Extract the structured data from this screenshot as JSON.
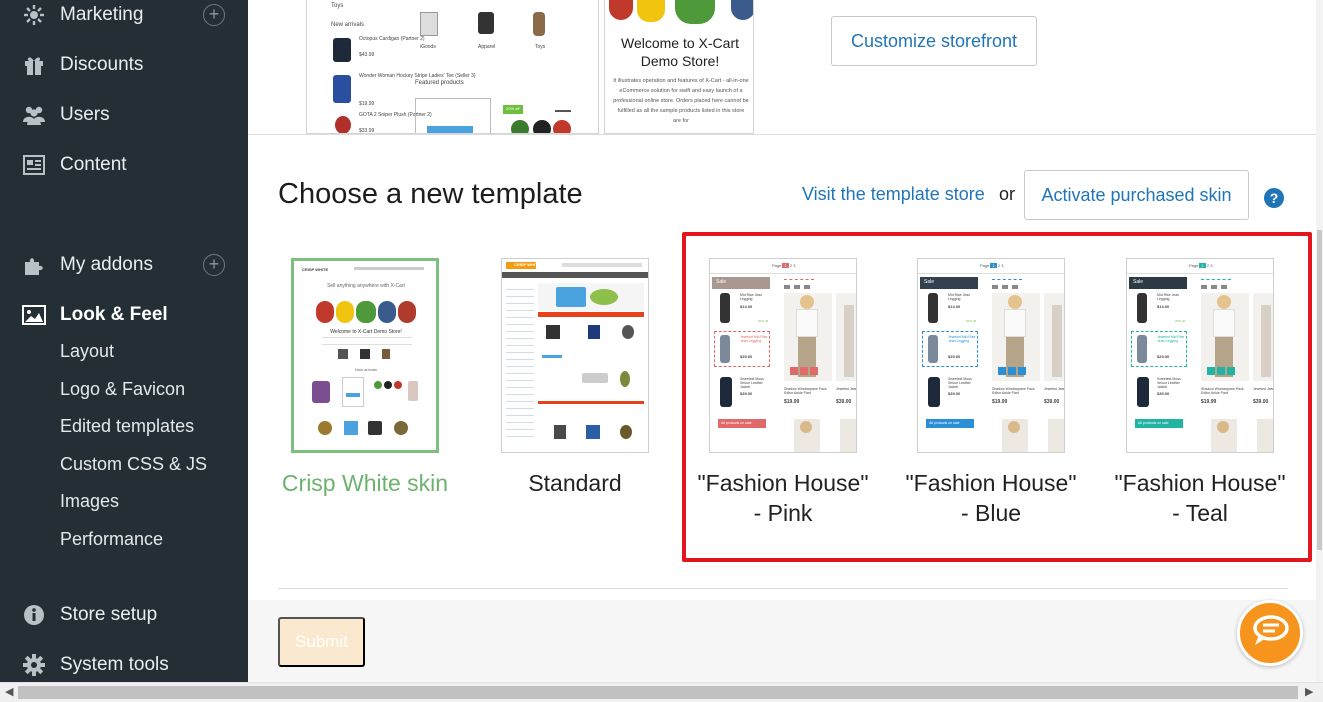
{
  "sidebar": {
    "items": [
      {
        "label": "Marketing",
        "icon": "marketing-icon",
        "has_add": true
      },
      {
        "label": "Discounts",
        "icon": "gift-icon",
        "has_add": false
      },
      {
        "label": "Users",
        "icon": "users-icon",
        "has_add": false
      },
      {
        "label": "Content",
        "icon": "content-icon",
        "has_add": false
      },
      {
        "label": "My addons",
        "icon": "puzzle-icon",
        "has_add": true
      },
      {
        "label": "Look & Feel",
        "icon": "image-icon",
        "has_add": false,
        "active": true
      },
      {
        "label": "Store setup",
        "icon": "info-icon",
        "has_add": false
      },
      {
        "label": "System tools",
        "icon": "gear-icon",
        "has_add": false
      }
    ],
    "add_symbol": "+",
    "look_feel_subitems": [
      "Layout",
      "Logo & Favicon",
      "Edited templates",
      "Custom CSS & JS",
      "Images",
      "Performance"
    ]
  },
  "current_preview": {
    "mini_texts": {
      "toys": "Toys",
      "new_arrivals": "New arrivals",
      "p1": "Octopus Cardigan (Partner 2)",
      "p1_price": "$43.99",
      "p2": "Wonder Woman Hockey Stripe Ladies' Tee (Seller 3)",
      "p2_price": "$19.99",
      "p3": "GOTA 2 Sniper Plush (Partner 2)",
      "p3_price": "$33.99",
      "cat1": "iGoods",
      "cat2": "Apparel",
      "cat3": "Toys",
      "featured": "Featured products",
      "sale_badge": "20% off"
    },
    "welcome_title": "Welcome to X-Cart Demo Store!",
    "welcome_body": "It illustrates operation and features of X-Cart - all-in-one eCommerce solution for swift and easy launch of a professional online store. Orders placed here cannot be fulfilled as all the sample products listed in this store are for"
  },
  "customize_button": "Customize storefront",
  "section": {
    "title": "Choose a new template",
    "visit_link": "Visit the template store",
    "or": "or",
    "activate_button": "Activate purchased skin",
    "help": "?"
  },
  "templates": [
    {
      "name": "Crisp White skin",
      "selected": true
    },
    {
      "name": "Standard",
      "selected": false
    },
    {
      "name": "\"Fashion House\" - Pink",
      "selected": false,
      "accent": "#a89890"
    },
    {
      "name": "\"Fashion House\" - Blue",
      "selected": false,
      "accent": "#33414f"
    },
    {
      "name": "\"Fashion House\" - Teal",
      "selected": false,
      "accent": "#2c3a44"
    }
  ],
  "crisp_mock": {
    "logo": "CRISP WHITE",
    "headline": "Sell anything anywhere with X-Cart",
    "welcome": "Welcome to X-Cart Demo Store!",
    "new_arrivals": "New arrivals"
  },
  "standard_mock": {
    "logo": "CRISP WHITE"
  },
  "fashion_mock": {
    "sale": "Sale",
    "page_label": "Page",
    "pages": [
      "1",
      "2",
      "3"
    ],
    "item1": "Mid Rise Jean Legging",
    "item1_price": "$14.00",
    "item2": "Jeweled Mid Rise Jean Legging",
    "item2_price": "$29.00",
    "item3": "Sweetest Moss Velour Leather Jacket",
    "item3_price": "$39.00",
    "product_name": "Shadow Windowpane Pack Editor Ankle Pant",
    "product_price": "$19.99",
    "product2": "Jeweled Jean Leg",
    "product2_price": "$39.00",
    "all_on_sale": "All products on sale",
    "off": "20% off"
  },
  "colors": {
    "sidebar_bg": "#232f34",
    "link": "#1f75b8",
    "selected_green": "#7cc07f",
    "highlight_red": "#e3161f",
    "pink_accent": "#e06a6a",
    "blue_accent": "#2b8fd6",
    "teal_accent": "#21b3a3",
    "chat_orange": "#f7941d"
  },
  "submit_button": "Submit"
}
